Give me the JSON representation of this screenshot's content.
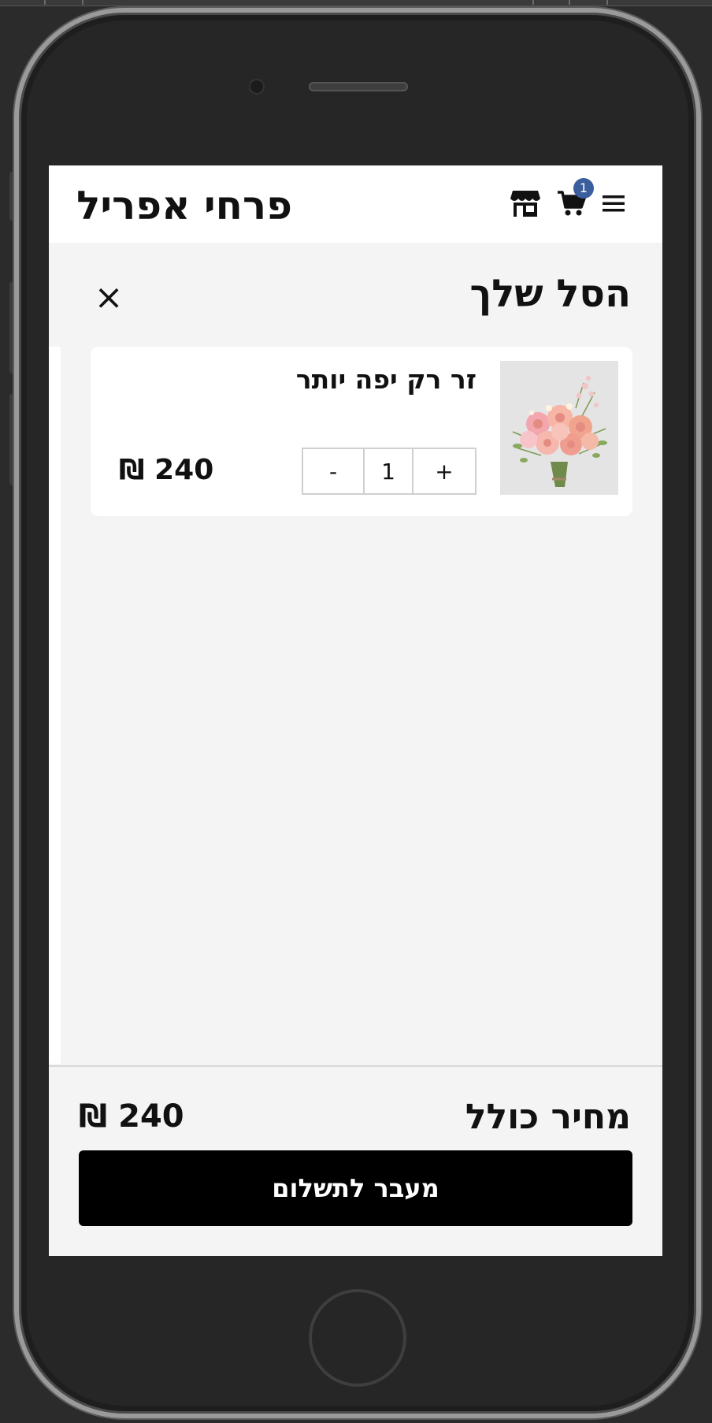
{
  "header": {
    "brand": "פרחי אפריל",
    "cart_count": "1",
    "icons": [
      "menu-icon",
      "cart-icon",
      "store-icon"
    ]
  },
  "cart": {
    "title": "הסל שלך",
    "close_label": "×",
    "items": [
      {
        "name": "זר רק יפה יותר",
        "quantity": "1",
        "minus_label": "-",
        "plus_label": "+",
        "price": "240 ₪",
        "image": "pink-flower-bouquet"
      }
    ]
  },
  "footer": {
    "total_label": "מחיר כולל",
    "total_price": "240 ₪",
    "checkout_label": "מעבר לתשלום"
  },
  "colors": {
    "badge": "#3b5e9c",
    "checkout_bg": "#000000",
    "page_bg": "#f4f4f4"
  }
}
